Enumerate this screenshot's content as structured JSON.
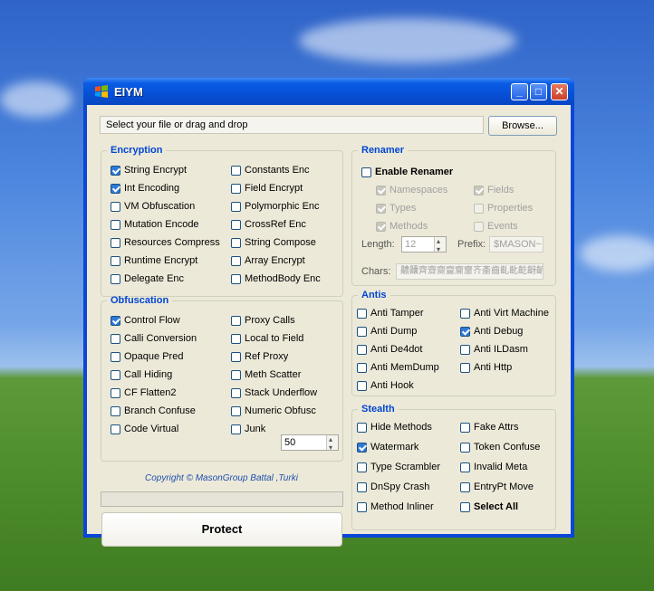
{
  "window": {
    "title": "EIYM"
  },
  "file": {
    "placeholder": "Select your file or drag and drop",
    "browse_label": "Browse..."
  },
  "encryption": {
    "title": "Encryption",
    "items": [
      {
        "label": "String Encrypt",
        "checked": true
      },
      {
        "label": "Constants Enc",
        "checked": false
      },
      {
        "label": "Int Encoding",
        "checked": true
      },
      {
        "label": "Field Encrypt",
        "checked": false
      },
      {
        "label": "VM Obfuscation",
        "checked": false
      },
      {
        "label": "Polymorphic Enc",
        "checked": false
      },
      {
        "label": "Mutation Encode",
        "checked": false
      },
      {
        "label": "CrossRef Enc",
        "checked": false
      },
      {
        "label": "Resources Compress",
        "checked": false
      },
      {
        "label": "String Compose",
        "checked": false
      },
      {
        "label": "Runtime Encrypt",
        "checked": false
      },
      {
        "label": "Array Encrypt",
        "checked": false
      },
      {
        "label": "Delegate Enc",
        "checked": false
      },
      {
        "label": "MethodBody Enc",
        "checked": false
      }
    ]
  },
  "obfuscation": {
    "title": "Obfuscation",
    "items": [
      {
        "label": "Control Flow",
        "checked": true
      },
      {
        "label": "Proxy Calls",
        "checked": false
      },
      {
        "label": "Calli Conversion",
        "checked": false
      },
      {
        "label": "Local to Field",
        "checked": false
      },
      {
        "label": "Opaque Pred",
        "checked": false
      },
      {
        "label": "Ref Proxy",
        "checked": false
      },
      {
        "label": "Call Hiding",
        "checked": false
      },
      {
        "label": "Meth Scatter",
        "checked": false
      },
      {
        "label": "CF Flatten2",
        "checked": false
      },
      {
        "label": "Stack Underflow",
        "checked": false
      },
      {
        "label": "Branch Confuse",
        "checked": false
      },
      {
        "label": "Numeric Obfusc",
        "checked": false
      },
      {
        "label": "Code Virtual",
        "checked": false
      },
      {
        "label": "Junk",
        "checked": false
      }
    ],
    "junk_value": "50"
  },
  "renamer": {
    "title": "Renamer",
    "enable_label": "Enable Renamer",
    "items": [
      {
        "label": "Namespaces",
        "checked": true
      },
      {
        "label": "Fields",
        "checked": true
      },
      {
        "label": "Types",
        "checked": true
      },
      {
        "label": "Properties",
        "checked": false
      },
      {
        "label": "Methods",
        "checked": true
      },
      {
        "label": "Events",
        "checked": false
      }
    ],
    "length_label": "Length:",
    "length_value": "12",
    "prefix_label": "Prefix:",
    "prefix_value": "$MASON~",
    "chars_label": "Chars:",
    "chars_value": "齈齉齊齋齌齍齎齏齐齑齒齓齔齕齖齗齘齙齚齛齜齝齞齟齠齡"
  },
  "anti": {
    "title": "Antis",
    "items": [
      {
        "label": "Anti Tamper",
        "checked": false
      },
      {
        "label": "Anti Virt Machine",
        "checked": false
      },
      {
        "label": "Anti Dump",
        "checked": false
      },
      {
        "label": "Anti Debug",
        "checked": true
      },
      {
        "label": "Anti De4dot",
        "checked": false
      },
      {
        "label": "Anti ILDasm",
        "checked": false
      },
      {
        "label": "Anti MemDump",
        "checked": false
      },
      {
        "label": "Anti Http",
        "checked": false
      },
      {
        "label": "Anti Hook",
        "checked": false
      }
    ]
  },
  "stealth": {
    "title": "Stealth",
    "items": [
      {
        "label": "Hide Methods",
        "checked": false
      },
      {
        "label": "Fake Attrs",
        "checked": false
      },
      {
        "label": "Watermark",
        "checked": true
      },
      {
        "label": "Token Confuse",
        "checked": false
      },
      {
        "label": "Type Scrambler",
        "checked": false
      },
      {
        "label": "Invalid Meta",
        "checked": false
      },
      {
        "label": "DnSpy Crash",
        "checked": false
      },
      {
        "label": "EntryPt Move",
        "checked": false
      },
      {
        "label": "Method Inliner",
        "checked": false
      },
      {
        "label": "Select All",
        "checked": false
      }
    ]
  },
  "copyright": "Copyright © MasonGroup Battal ,Turki",
  "protect_label": "Protect"
}
